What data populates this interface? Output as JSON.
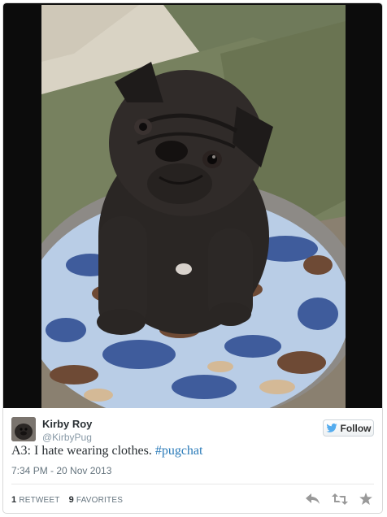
{
  "user": {
    "name": "Kirby Roy",
    "handle": "@KirbyPug",
    "follow_label": "Follow"
  },
  "tweet": {
    "text_prefix": "A3: I hate wearing clothes.",
    "hashtag": "#pugchat",
    "timestamp": "7:34 PM - 20 Nov 2013"
  },
  "stats": {
    "retweet_count": "1",
    "retweet_label": "RETWEET",
    "favorite_count": "9",
    "favorite_label": "FAVORITES"
  },
  "icons": {
    "reply": "reply-icon",
    "retweet": "retweet-icon",
    "favorite": "star-icon",
    "twitter_bird": "twitter-bird-icon"
  },
  "colors": {
    "link": "#2b7bb9",
    "twitter_blue": "#55acee",
    "action_gray": "#999999"
  }
}
